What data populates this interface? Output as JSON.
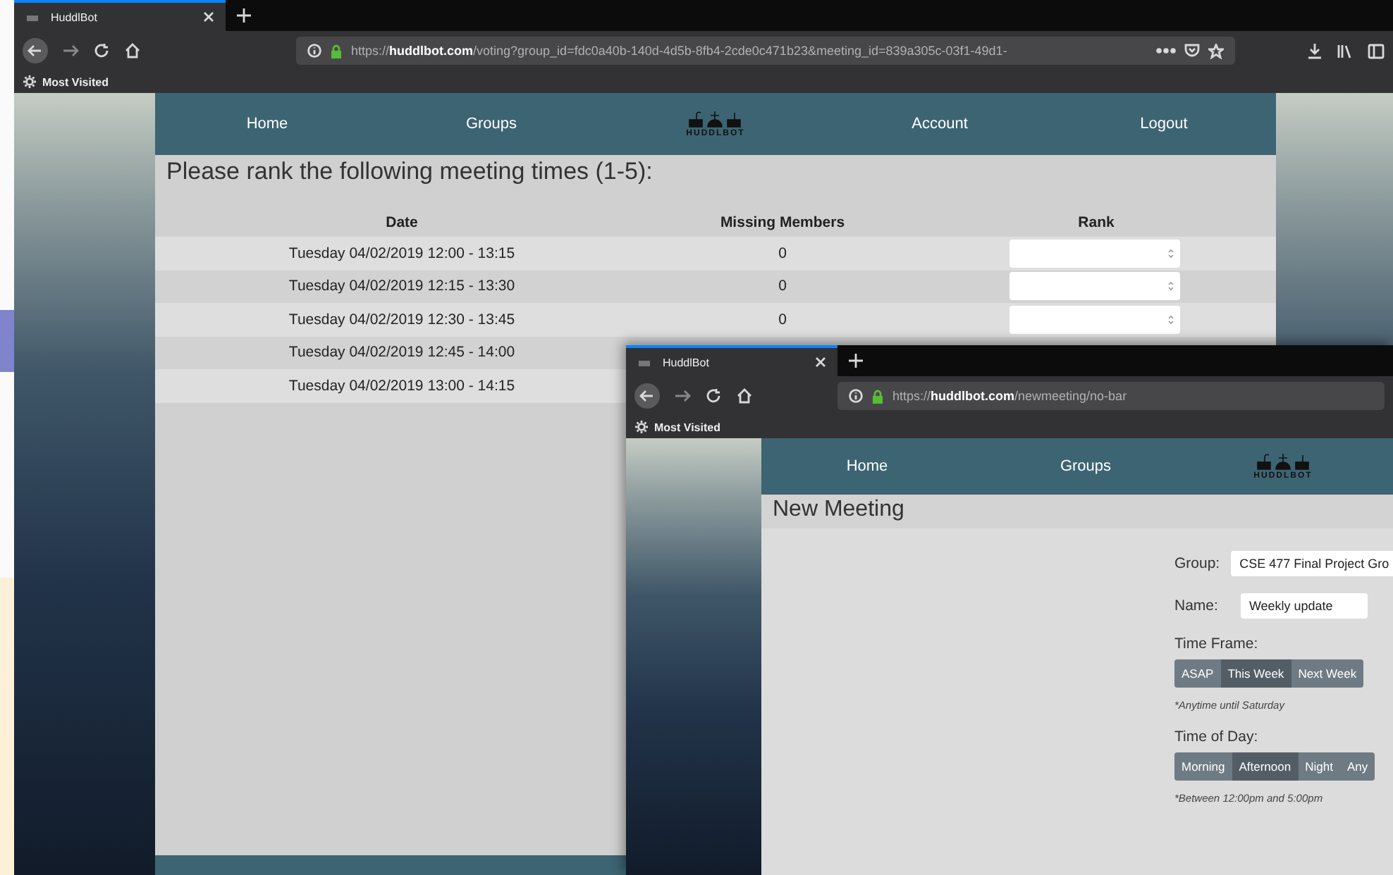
{
  "windows": [
    {
      "kind": "voting",
      "tab": {
        "title": "HuddlBot"
      },
      "url": "https://**huddlbot.com**/voting?group_id=fdc0a40b-140d-4d5b-8fb4-2cde0c471b23&meeting_id=839a305c-03f1-49d1-",
      "url_actions": true,
      "bookmarks": [
        "Most Visited"
      ],
      "nav": [
        {
          "kind": "link",
          "label": "Home"
        },
        {
          "kind": "link",
          "label": "Groups"
        },
        {
          "kind": "logo",
          "label": "HUDDLBOT"
        },
        {
          "kind": "link",
          "label": "Account"
        },
        {
          "kind": "link",
          "label": "Logout"
        }
      ],
      "heading": "Please rank the following meeting times (1-5):",
      "table": {
        "columns": [
          "Date",
          "Missing Members",
          "Rank"
        ],
        "rows": [
          {
            "date": "Tuesday 04/02/2019 12:00 - 13:15",
            "missing": "0"
          },
          {
            "date": "Tuesday 04/02/2019 12:15 - 13:30",
            "missing": "0"
          },
          {
            "date": "Tuesday 04/02/2019 12:30 - 13:45",
            "missing": "0"
          },
          {
            "date": "Tuesday 04/02/2019 12:45 - 14:00"
          },
          {
            "date": "Tuesday 04/02/2019 13:00 - 14:15"
          }
        ]
      }
    },
    {
      "kind": "new_meeting",
      "tab": {
        "title": "HuddlBot"
      },
      "url": "https://**huddlbot.com**/newmeeting/no-bar",
      "url_actions": false,
      "bookmarks": [
        "Most Visited"
      ],
      "nav": [
        {
          "kind": "link",
          "label": "Home"
        },
        {
          "kind": "link",
          "label": "Groups"
        },
        {
          "kind": "logo",
          "label": "HUDDLBOT"
        }
      ],
      "heading": "New Meeting",
      "form": {
        "group": {
          "label": "Group:",
          "value": "CSE 477 Final Project Gro"
        },
        "name": {
          "label": "Name:",
          "value": "Weekly update"
        },
        "time_frame": {
          "label": "Time Frame:",
          "note": "*Anytime until Saturday",
          "options": [
            {
              "label": "ASAP",
              "selected": false
            },
            {
              "label": "This Week",
              "selected": true
            },
            {
              "label": "Next Week",
              "selected": false
            }
          ]
        },
        "time_of_day": {
          "label": "Time of Day:",
          "note": "*Between 12:00pm and 5:00pm",
          "options": [
            {
              "label": "Morning",
              "selected": false
            },
            {
              "label": "Afternoon",
              "selected": true
            },
            {
              "label": "Night",
              "selected": false
            },
            {
              "label": "Any",
              "selected": false
            }
          ]
        }
      }
    }
  ]
}
